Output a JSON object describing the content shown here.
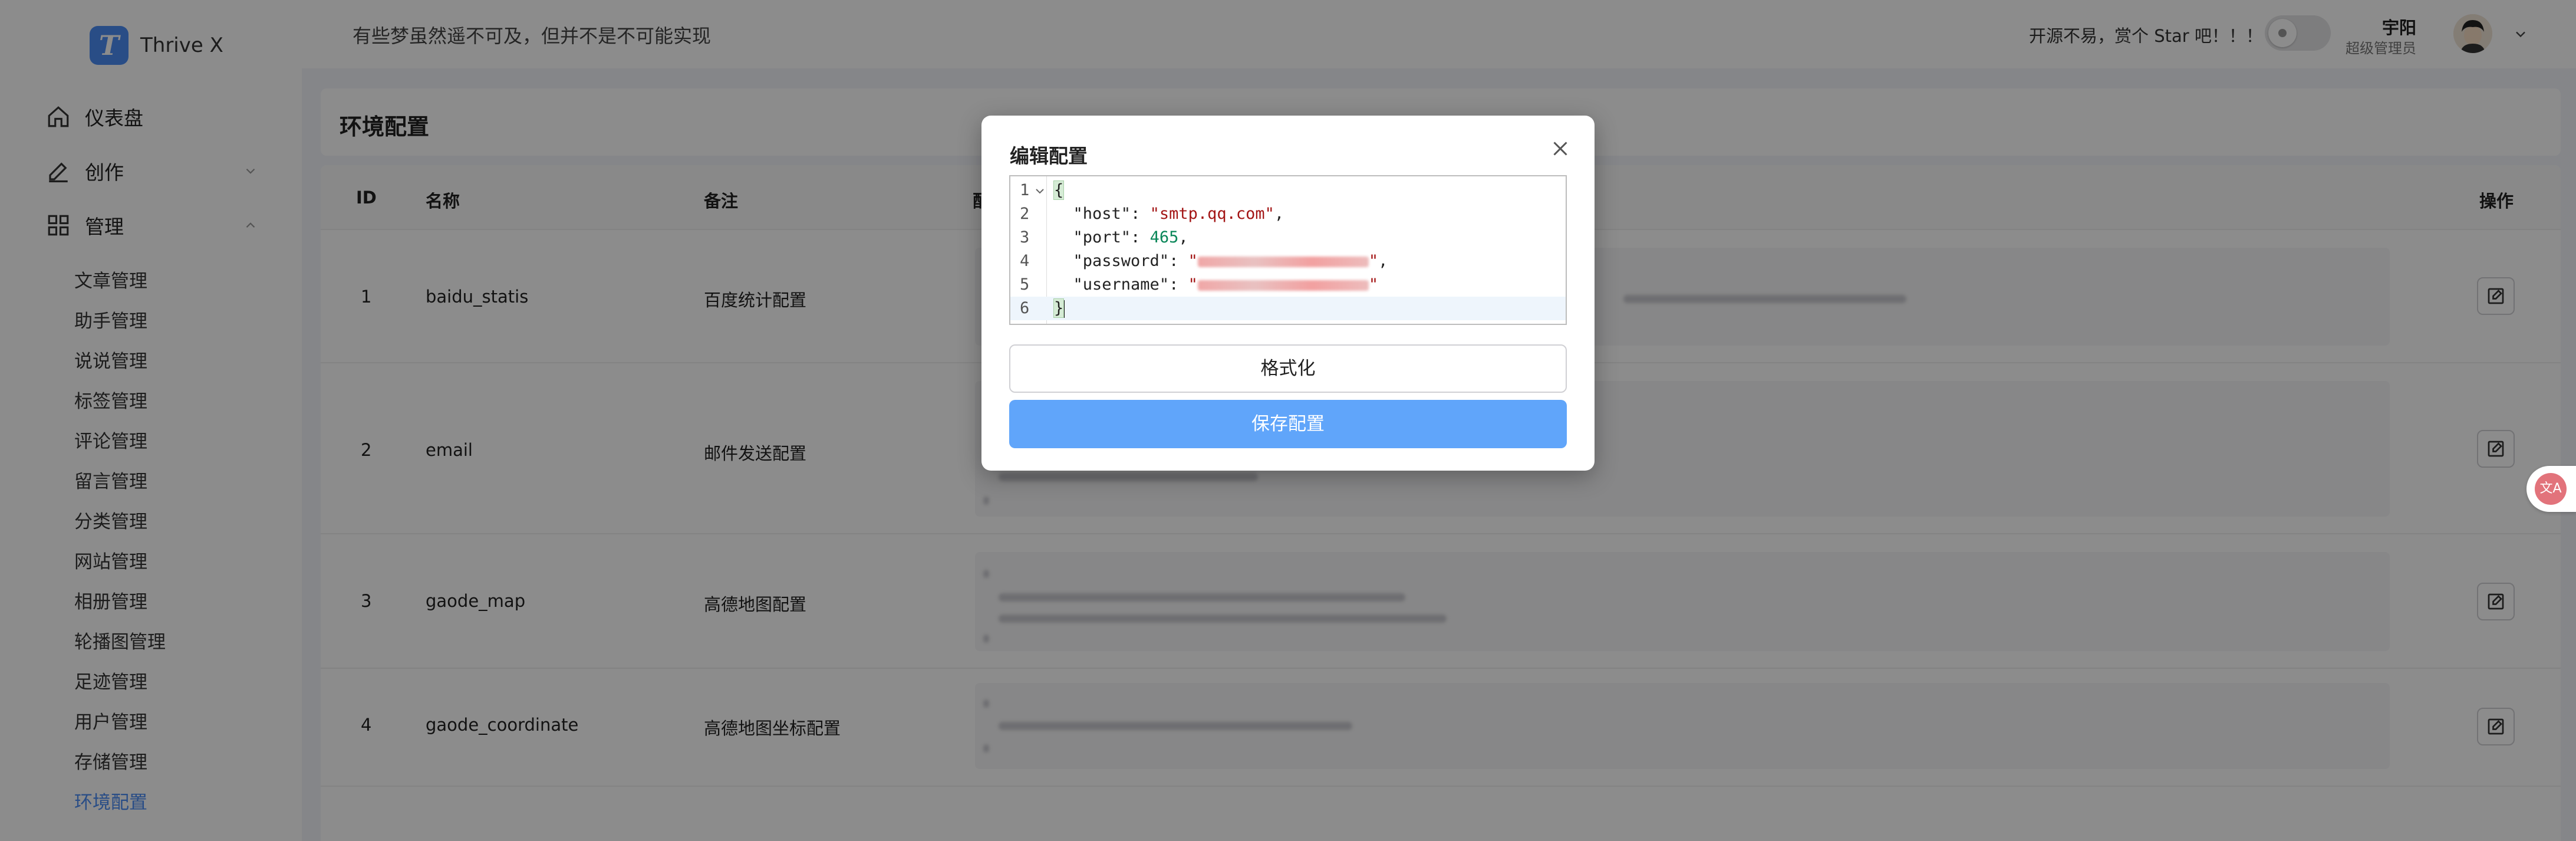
{
  "app": {
    "name": "Thrive X",
    "logo_letter": "T"
  },
  "sidebar": {
    "top_items": [
      {
        "label": "仪表盘",
        "icon": "home-icon"
      },
      {
        "label": "创作",
        "icon": "pen-icon",
        "expanded": false
      },
      {
        "label": "管理",
        "icon": "grid-icon",
        "expanded": true
      }
    ],
    "sub_items": [
      "文章管理",
      "助手管理",
      "说说管理",
      "标签管理",
      "评论管理",
      "留言管理",
      "分类管理",
      "网站管理",
      "相册管理",
      "轮播图管理",
      "足迹管理",
      "用户管理",
      "存储管理",
      "环境配置"
    ],
    "active_sub_item": "环境配置"
  },
  "header": {
    "slogan": "有些梦虽然遥不可及，但并不是不可能实现",
    "star_text": "开源不易，赏个 Star 吧！！！",
    "user_name": "宇阳",
    "user_role": "超级管理员"
  },
  "page": {
    "title": "环境配置"
  },
  "table": {
    "columns": [
      "ID",
      "名称",
      "备注",
      "配",
      "操作"
    ],
    "rows": [
      {
        "id": "1",
        "name": "baidu_statis",
        "note": "百度统计配置"
      },
      {
        "id": "2",
        "name": "email",
        "note": "邮件发送配置"
      },
      {
        "id": "3",
        "name": "gaode_map",
        "note": "高德地图配置"
      },
      {
        "id": "4",
        "name": "gaode_coordinate",
        "note": "高德地图坐标配置"
      }
    ]
  },
  "modal": {
    "title": "编辑配置",
    "code": {
      "line_numbers": [
        "1",
        "2",
        "3",
        "4",
        "5",
        "6"
      ],
      "open_brace": "{",
      "close_brace": "}",
      "host_key": "\"host\"",
      "host_value": "\"smtp.qq.com\"",
      "port_key": "\"port\"",
      "port_value": "465",
      "password_key": "\"password\"",
      "username_key": "\"username\"",
      "colon": ": ",
      "comma": ",",
      "quote": "\""
    },
    "format_button": "格式化",
    "save_button": "保存配置"
  },
  "widget": {
    "translate_label": "文A"
  },
  "colors": {
    "accent": "#4c8cf5",
    "save_button": "#60a5fa",
    "string": "#a31515",
    "number": "#098658"
  }
}
